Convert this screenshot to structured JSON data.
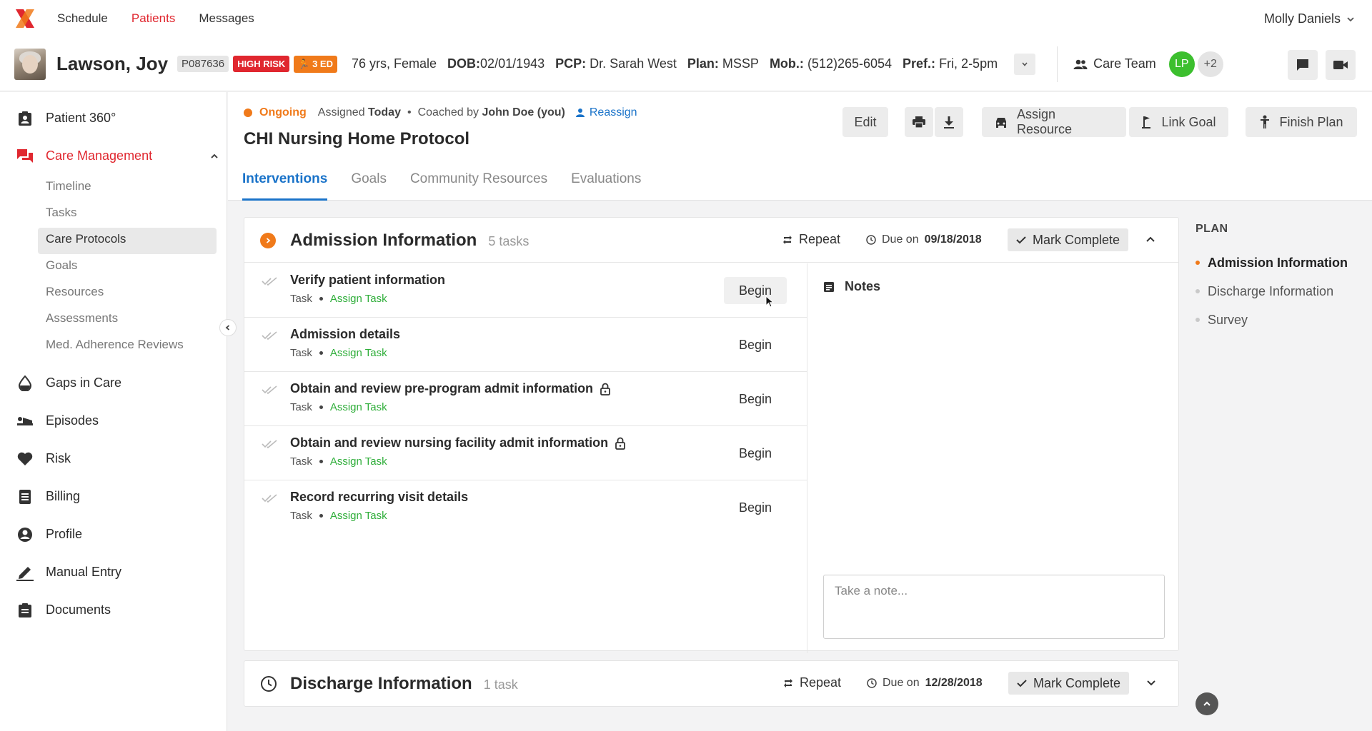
{
  "nav": {
    "links": [
      "Schedule",
      "Patients",
      "Messages"
    ],
    "active_index": 1,
    "user_name": "Molly Daniels"
  },
  "patient": {
    "name": "Lawson, Joy",
    "id": "P087636",
    "risk_badge": "HIGH RISK",
    "ed_badge": "3 ED",
    "age_sex": "76 yrs, Female",
    "dob_label": "DOB:",
    "dob": "02/01/1943",
    "pcp_label": "PCP:",
    "pcp": "Dr. Sarah West",
    "plan_label": "Plan:",
    "plan": "MSSP",
    "mob_label": "Mob.:",
    "mob": "(512)265-6054",
    "pref_label": "Pref.:",
    "pref": "Fri, 2-5pm",
    "care_team_label": "Care Team",
    "care_team_initials": "LP",
    "care_team_more": "+2"
  },
  "sidebar": {
    "items": [
      {
        "label": "Patient 360°",
        "icon": "clipboard-user-icon"
      },
      {
        "label": "Care Management",
        "icon": "chat-bubbles-icon",
        "active": true
      },
      {
        "label": "Gaps in Care",
        "icon": "drop-icon"
      },
      {
        "label": "Episodes",
        "icon": "bed-icon"
      },
      {
        "label": "Risk",
        "icon": "heart-icon"
      },
      {
        "label": "Billing",
        "icon": "receipt-icon"
      },
      {
        "label": "Profile",
        "icon": "person-circle-icon"
      },
      {
        "label": "Manual Entry",
        "icon": "pencil-icon"
      },
      {
        "label": "Documents",
        "icon": "clipboard-icon"
      }
    ],
    "sub_items": [
      "Timeline",
      "Tasks",
      "Care Protocols",
      "Goals",
      "Resources",
      "Assessments",
      "Med. Adherence Reviews"
    ],
    "sub_active_index": 2
  },
  "plan_header": {
    "status": "Ongoing",
    "assigned_label": "Assigned",
    "assigned_when": "Today",
    "coached_label": "Coached by",
    "coach": "John Doe (you)",
    "reassign": "Reassign",
    "title": "CHI Nursing Home Protocol",
    "edit": "Edit",
    "assign_resource": "Assign Resource",
    "link_goal": "Link Goal",
    "finish_plan": "Finish Plan"
  },
  "tabs": [
    "Interventions",
    "Goals",
    "Community Resources",
    "Evaluations"
  ],
  "active_tab": 0,
  "sections": [
    {
      "title": "Admission Information",
      "count": "5 tasks",
      "repeat": "Repeat",
      "due_label": "Due on",
      "due_date": "09/18/2018",
      "mark_complete": "Mark Complete",
      "tasks": [
        {
          "name": "Verify patient information",
          "type": "Task",
          "assign": "Assign Task",
          "action": "Begin",
          "locked": false
        },
        {
          "name": "Admission details",
          "type": "Task",
          "assign": "Assign Task",
          "action": "Begin",
          "locked": false
        },
        {
          "name": "Obtain and review pre-program admit information",
          "type": "Task",
          "assign": "Assign Task",
          "action": "Begin",
          "locked": true
        },
        {
          "name": "Obtain and review nursing facility admit information",
          "type": "Task",
          "assign": "Assign Task",
          "action": "Begin",
          "locked": true
        },
        {
          "name": "Record recurring visit details",
          "type": "Task",
          "assign": "Assign Task",
          "action": "Begin",
          "locked": false
        }
      ],
      "notes_title": "Notes",
      "note_placeholder": "Take a note..."
    },
    {
      "title": "Discharge Information",
      "count": "1 task",
      "repeat": "Repeat",
      "due_label": "Due on",
      "due_date": "12/28/2018",
      "mark_complete": "Mark Complete"
    }
  ],
  "plan_panel": {
    "label": "PLAN",
    "items": [
      "Admission Information",
      "Discharge Information",
      "Survey"
    ],
    "active_index": 0
  },
  "colors": {
    "brand_red": "#e0272f",
    "accent_orange": "#f07a1a",
    "link_blue": "#1a73c9",
    "assign_green": "#2fae3a",
    "avatar_green": "#3cbf2e"
  }
}
